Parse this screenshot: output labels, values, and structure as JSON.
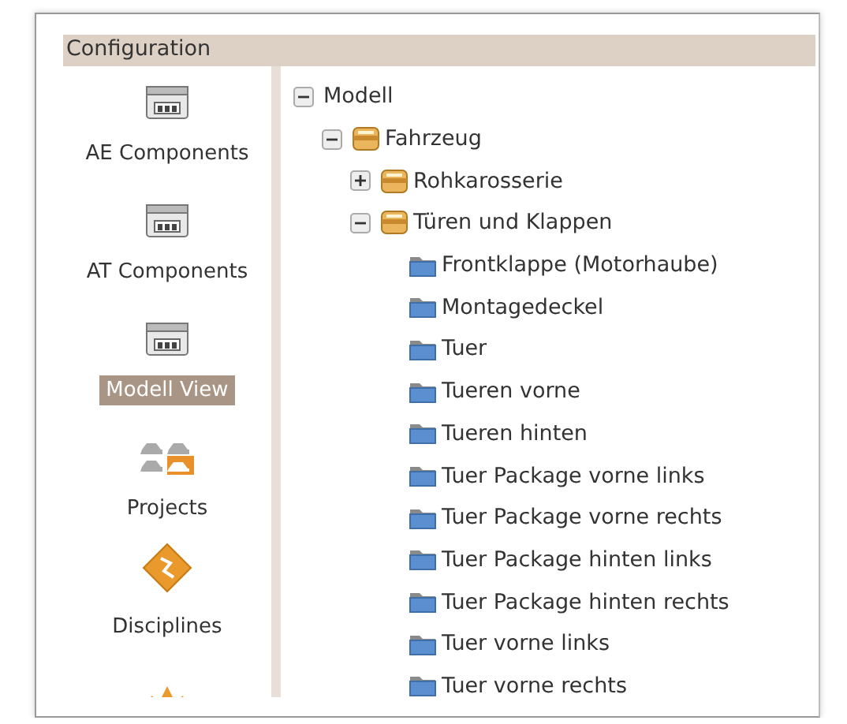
{
  "panel": {
    "title": "Configuration"
  },
  "sidebar": {
    "items": [
      {
        "label": "AE Components",
        "kind": "cabinet",
        "selected": false
      },
      {
        "label": "AT Components",
        "kind": "cabinet",
        "selected": false
      },
      {
        "label": "Modell View",
        "kind": "cabinet",
        "selected": true
      },
      {
        "label": "Projects",
        "kind": "cars",
        "selected": false
      },
      {
        "label": "Disciplines",
        "kind": "diamond",
        "selected": false
      },
      {
        "kind": "star"
      }
    ]
  },
  "tree": [
    {
      "label": "Modell",
      "expanded": true,
      "children": [
        {
          "label": "Fahrzeug",
          "kind": "assembly",
          "expanded": true,
          "children": [
            {
              "label": "Rohkarosserie",
              "kind": "assembly",
              "expanded": false
            },
            {
              "label": "Türen und Klappen",
              "kind": "assembly",
              "expanded": true,
              "children": [
                {
                  "label": "Frontklappe (Motorhaube)",
                  "kind": "folder"
                },
                {
                  "label": "Montagedeckel",
                  "kind": "folder"
                },
                {
                  "label": "Tuer",
                  "kind": "folder"
                },
                {
                  "label": "Tueren vorne",
                  "kind": "folder"
                },
                {
                  "label": "Tueren hinten",
                  "kind": "folder"
                },
                {
                  "label": "Tuer Package vorne links",
                  "kind": "folder"
                },
                {
                  "label": "Tuer Package vorne rechts",
                  "kind": "folder"
                },
                {
                  "label": "Tuer Package hinten links",
                  "kind": "folder"
                },
                {
                  "label": "Tuer Package hinten rechts",
                  "kind": "folder"
                },
                {
                  "label": "Tuer vorne links",
                  "kind": "folder"
                },
                {
                  "label": "Tuer vorne rechts",
                  "kind": "folder"
                }
              ]
            }
          ]
        }
      ]
    }
  ]
}
